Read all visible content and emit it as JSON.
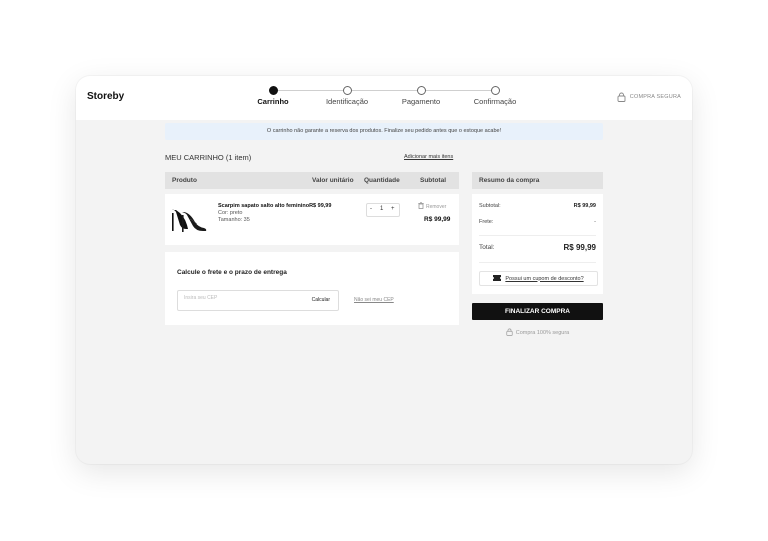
{
  "header": {
    "brand": "Storeby",
    "steps": [
      {
        "label": "Carrinho",
        "active": true
      },
      {
        "label": "Identificação",
        "active": false
      },
      {
        "label": "Pagamento",
        "active": false
      },
      {
        "label": "Confirmação",
        "active": false
      }
    ],
    "secure_label": "COMPRA SEGURA"
  },
  "notice": "O carrinho não garante a reserva dos produtos. Finalize seu pedido antes que o estoque acabe!",
  "cart": {
    "title": "MEU CARRINHO (1 item)",
    "add_more": "Adicionar mais itens",
    "columns": {
      "product": "Produto",
      "unit_price": "Valor unitário",
      "quantity": "Quantidade",
      "subtotal": "Subtotal"
    },
    "items": [
      {
        "name": "Scarpim sapato salto alto feminino",
        "unit_price": "R$ 99,99",
        "color": "Cor: preto",
        "size": "Tamanho: 35",
        "quantity": "1",
        "minus": "-",
        "plus": "+",
        "remove": "Remover",
        "total": "R$ 99,99"
      }
    ]
  },
  "shipping": {
    "title": "Calcule o frete e o prazo de entrega",
    "placeholder": "Insira seu CEP",
    "calc_button": "Calcular",
    "no_cep": "Não sei meu CEP"
  },
  "summary": {
    "title": "Resumo da compra",
    "subtotal_label": "Subtotal:",
    "subtotal_value": "R$ 99,99",
    "shipping_label": "Frete:",
    "shipping_value": "-",
    "total_label": "Total:",
    "total_value": "R$ 99,99",
    "coupon": "Possui um cupom de desconto?",
    "finalize": "FINALIZAR COMPRA",
    "secure": "Compra 100% segura"
  },
  "colors": {
    "accent": "#111111",
    "notice_bg": "#e8f1fb",
    "panel_header": "#e2e2e2",
    "background": "#f3f3f3"
  }
}
